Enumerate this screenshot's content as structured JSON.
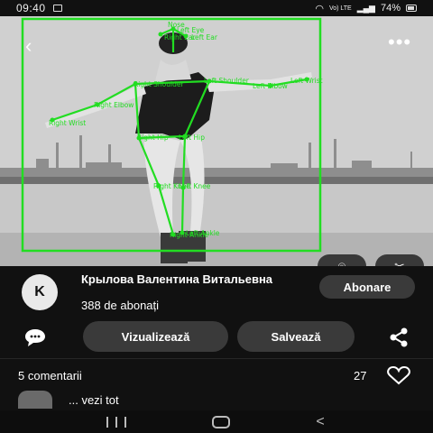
{
  "status_bar": {
    "time": "09:40",
    "network": "Vo) LTE",
    "battery": "74%"
  },
  "photo": {
    "overlay_color": "#22dd22",
    "keypoint_labels": [
      "Nose",
      "Left Eye",
      "Right Ear",
      "Left Ear",
      "Right Shoulder",
      "Left Shoulder",
      "Right Elbow",
      "Left Elbow",
      "Right Wrist",
      "Left Wrist",
      "Right Hip",
      "Left Hip",
      "Right Knee",
      "Left Knee",
      "Right Ankle",
      "Left Ankle"
    ]
  },
  "pin": {
    "avatar_letter": "K",
    "author_name": "Крылова Валентина Витальевна",
    "followers": "388 de abonați",
    "follow_label": "Abonare",
    "view_label": "Vizualizează",
    "save_label": "Salvează"
  },
  "comments": {
    "count_label": "5 comentarii",
    "likes": "27",
    "view_all": "... vezi tot"
  }
}
